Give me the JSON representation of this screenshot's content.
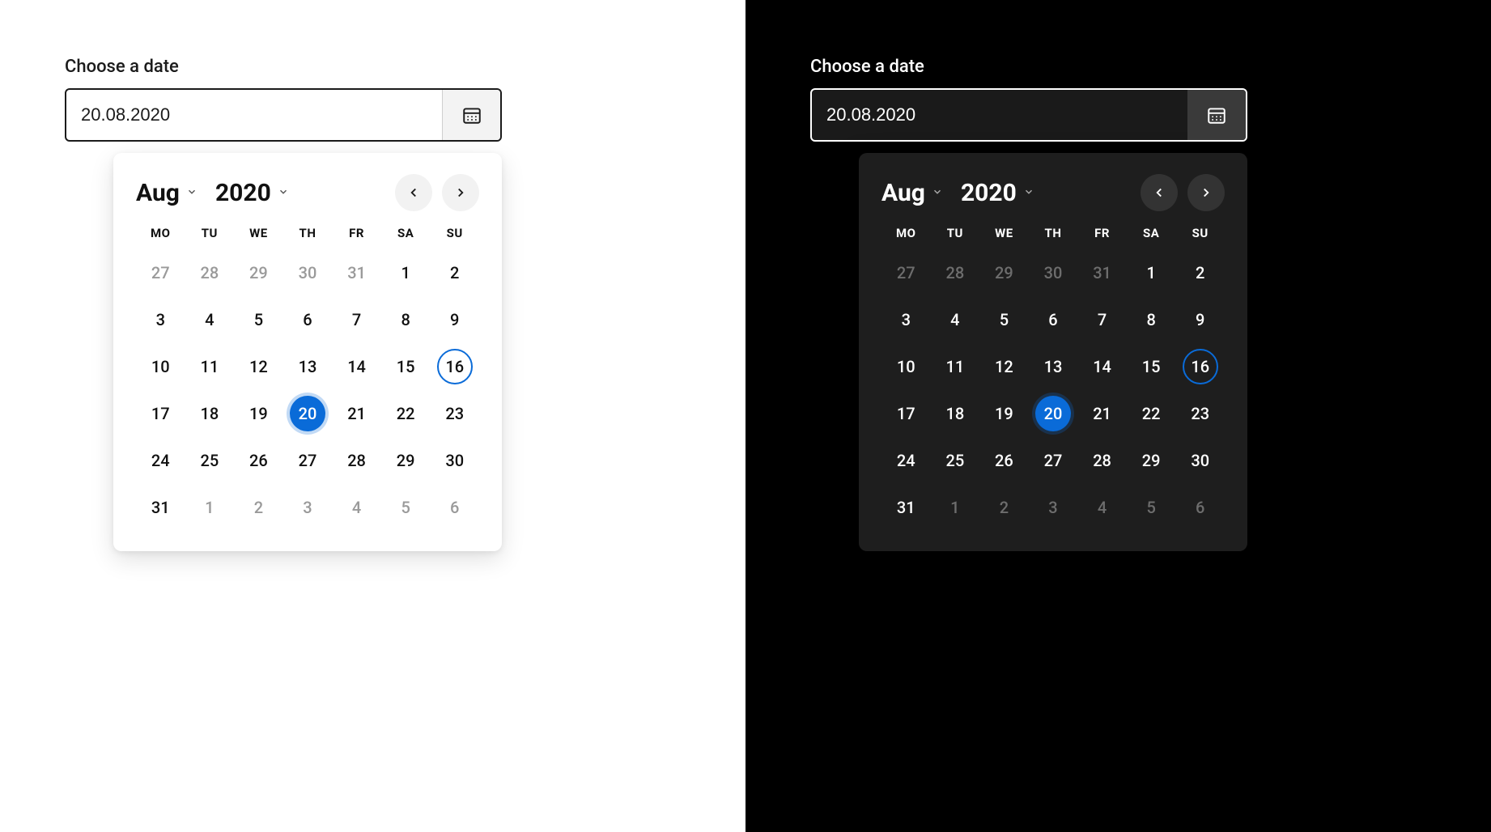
{
  "colors": {
    "accent": "#0a6bd8"
  },
  "light": {
    "label": "Choose a date",
    "input_value": "20.08.2020",
    "month_label": "Aug",
    "year_label": "2020",
    "weekdays": [
      "MO",
      "TU",
      "WE",
      "TH",
      "FR",
      "SA",
      "SU"
    ],
    "weeks": [
      [
        {
          "n": "27",
          "out": true
        },
        {
          "n": "28",
          "out": true
        },
        {
          "n": "29",
          "out": true
        },
        {
          "n": "30",
          "out": true
        },
        {
          "n": "31",
          "out": true
        },
        {
          "n": "1"
        },
        {
          "n": "2"
        }
      ],
      [
        {
          "n": "3"
        },
        {
          "n": "4"
        },
        {
          "n": "5"
        },
        {
          "n": "6"
        },
        {
          "n": "7"
        },
        {
          "n": "8"
        },
        {
          "n": "9"
        }
      ],
      [
        {
          "n": "10"
        },
        {
          "n": "11"
        },
        {
          "n": "12"
        },
        {
          "n": "13"
        },
        {
          "n": "14"
        },
        {
          "n": "15"
        },
        {
          "n": "16",
          "today": true
        }
      ],
      [
        {
          "n": "17"
        },
        {
          "n": "18"
        },
        {
          "n": "19"
        },
        {
          "n": "20",
          "selected": true
        },
        {
          "n": "21"
        },
        {
          "n": "22"
        },
        {
          "n": "23"
        }
      ],
      [
        {
          "n": "24"
        },
        {
          "n": "25"
        },
        {
          "n": "26"
        },
        {
          "n": "27"
        },
        {
          "n": "28"
        },
        {
          "n": "29"
        },
        {
          "n": "30"
        }
      ],
      [
        {
          "n": "31"
        },
        {
          "n": "1",
          "out": true
        },
        {
          "n": "2",
          "out": true
        },
        {
          "n": "3",
          "out": true
        },
        {
          "n": "4",
          "out": true
        },
        {
          "n": "5",
          "out": true
        },
        {
          "n": "6",
          "out": true
        }
      ]
    ]
  },
  "dark": {
    "label": "Choose a date",
    "input_value": "20.08.2020",
    "month_label": "Aug",
    "year_label": "2020",
    "weekdays": [
      "MO",
      "TU",
      "WE",
      "TH",
      "FR",
      "SA",
      "SU"
    ],
    "weeks": [
      [
        {
          "n": "27",
          "out": true
        },
        {
          "n": "28",
          "out": true
        },
        {
          "n": "29",
          "out": true
        },
        {
          "n": "30",
          "out": true
        },
        {
          "n": "31",
          "out": true
        },
        {
          "n": "1"
        },
        {
          "n": "2"
        }
      ],
      [
        {
          "n": "3"
        },
        {
          "n": "4"
        },
        {
          "n": "5"
        },
        {
          "n": "6"
        },
        {
          "n": "7"
        },
        {
          "n": "8"
        },
        {
          "n": "9"
        }
      ],
      [
        {
          "n": "10"
        },
        {
          "n": "11"
        },
        {
          "n": "12"
        },
        {
          "n": "13"
        },
        {
          "n": "14"
        },
        {
          "n": "15"
        },
        {
          "n": "16",
          "today": true
        }
      ],
      [
        {
          "n": "17"
        },
        {
          "n": "18"
        },
        {
          "n": "19"
        },
        {
          "n": "20",
          "selected": true
        },
        {
          "n": "21"
        },
        {
          "n": "22"
        },
        {
          "n": "23"
        }
      ],
      [
        {
          "n": "24"
        },
        {
          "n": "25"
        },
        {
          "n": "26"
        },
        {
          "n": "27"
        },
        {
          "n": "28"
        },
        {
          "n": "29"
        },
        {
          "n": "30"
        }
      ],
      [
        {
          "n": "31"
        },
        {
          "n": "1",
          "out": true
        },
        {
          "n": "2",
          "out": true
        },
        {
          "n": "3",
          "out": true
        },
        {
          "n": "4",
          "out": true
        },
        {
          "n": "5",
          "out": true
        },
        {
          "n": "6",
          "out": true
        }
      ]
    ]
  }
}
